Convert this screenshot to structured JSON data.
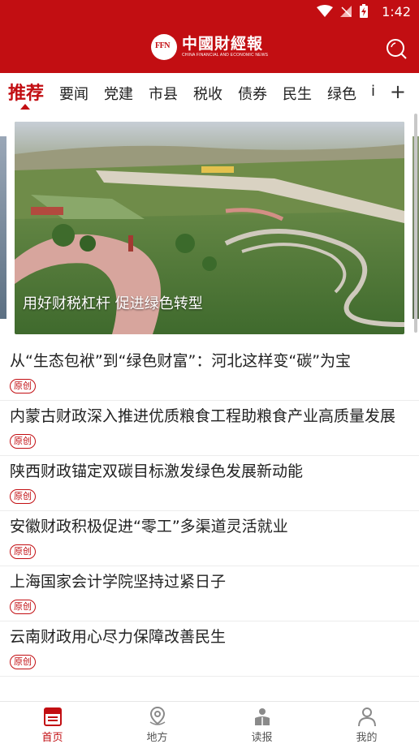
{
  "status_bar": {
    "time": "1:42"
  },
  "header": {
    "logo_mark": "FFN",
    "brand_name": "中國財經報",
    "brand_sub": "CHINA FINANCIAL AND ECONOMIC NEWS",
    "search_icon": "search-icon",
    "color": "#c20e12"
  },
  "tabs": {
    "items": [
      "推荐",
      "要闻",
      "党建",
      "市县",
      "税收",
      "债券",
      "民生",
      "绿色",
      "i"
    ],
    "active": "推荐",
    "more_label": "+"
  },
  "banner": {
    "caption": "用好财税杠杆 促进绿色转型"
  },
  "news": [
    {
      "title": "从“生态包袱”到“绿色财富”：河北这样变“碳”为宝",
      "badge": "原创"
    },
    {
      "title": "内蒙古财政深入推进优质粮食工程助粮食产业高质量发展",
      "badge": "原创"
    },
    {
      "title": "陕西财政锚定双碳目标激发绿色发展新动能",
      "badge": "原创"
    },
    {
      "title": "安徽财政积极促进“零工”多渠道灵活就业",
      "badge": "原创"
    },
    {
      "title": "上海国家会计学院坚持过紧日子",
      "badge": "原创"
    },
    {
      "title": "云南财政用心尽力保障改善民生",
      "badge": "原创"
    }
  ],
  "bottom_nav": [
    {
      "label": "首页",
      "icon": "newspaper-icon",
      "active": true
    },
    {
      "label": "地方",
      "icon": "location-pin-icon",
      "active": false
    },
    {
      "label": "读报",
      "icon": "reader-icon",
      "active": false
    },
    {
      "label": "我的",
      "icon": "profile-icon",
      "active": false
    }
  ]
}
